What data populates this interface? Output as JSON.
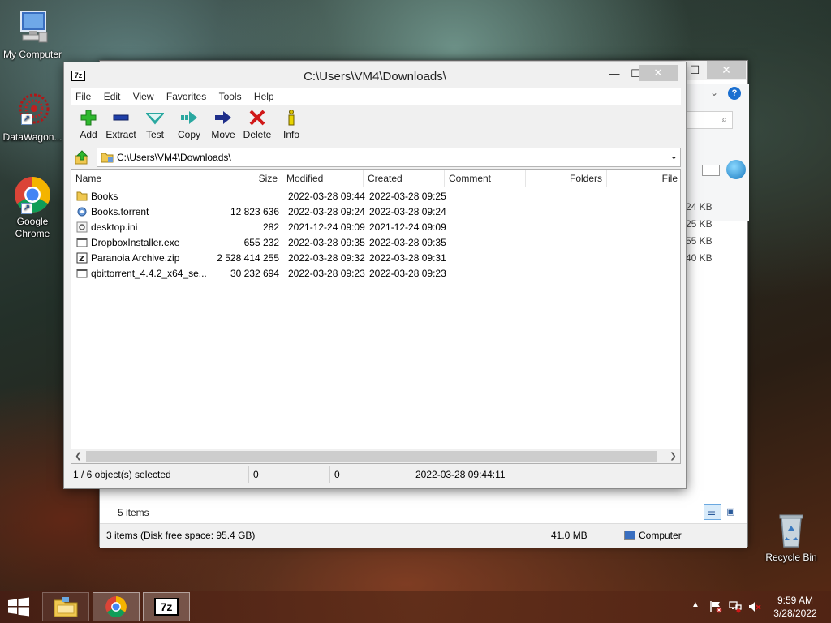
{
  "desktop": {
    "icons": [
      {
        "label": "My Computer"
      },
      {
        "label": "DataWagon..."
      },
      {
        "label": "Google Chrome"
      },
      {
        "label": "Recycle Bin"
      }
    ]
  },
  "bg_window": {
    "sizes": [
      "24 KB",
      "25 KB",
      "55 KB",
      "40 KB"
    ],
    "items_count": "5 items",
    "status_text": "3 items (Disk free space: 95.4 GB)",
    "status_size": "41.0 MB",
    "status_location": "Computer"
  },
  "window": {
    "title": "C:\\Users\\VM4\\Downloads\\",
    "app_icon": "7z",
    "menu": [
      "File",
      "Edit",
      "View",
      "Favorites",
      "Tools",
      "Help"
    ],
    "toolbar": [
      {
        "label": "Add",
        "icon": "plus-icon",
        "color": "#2eb82e"
      },
      {
        "label": "Extract",
        "icon": "minus-icon",
        "color": "#1f3fa8"
      },
      {
        "label": "Test",
        "icon": "check-icon",
        "color": "#2aa8a0"
      },
      {
        "label": "Copy",
        "icon": "copy-arrow-icon",
        "color": "#2aa8a0"
      },
      {
        "label": "Move",
        "icon": "move-arrow-icon",
        "color": "#1f2f8a"
      },
      {
        "label": "Delete",
        "icon": "x-icon",
        "color": "#d01818"
      },
      {
        "label": "Info",
        "icon": "info-icon",
        "color": "#d8c000"
      }
    ],
    "address": "C:\\Users\\VM4\\Downloads\\",
    "columns": [
      "Name",
      "Size",
      "Modified",
      "Created",
      "Comment",
      "Folders",
      "File"
    ],
    "files": [
      {
        "name": "Books",
        "size": "",
        "modified": "2022-03-28 09:44",
        "created": "2022-03-28 09:25",
        "icon": "folder-icon"
      },
      {
        "name": "Books.torrent",
        "size": "12 823 636",
        "modified": "2022-03-28 09:24",
        "created": "2022-03-28 09:24",
        "icon": "torrent-file-icon"
      },
      {
        "name": "desktop.ini",
        "size": "282",
        "modified": "2021-12-24 09:09",
        "created": "2021-12-24 09:09",
        "icon": "settings-file-icon"
      },
      {
        "name": "DropboxInstaller.exe",
        "size": "655 232",
        "modified": "2022-03-28 09:35",
        "created": "2022-03-28 09:35",
        "icon": "exe-file-icon"
      },
      {
        "name": "Paranoia Archive.zip",
        "size": "2 528 414 255",
        "modified": "2022-03-28 09:32",
        "created": "2022-03-28 09:31",
        "icon": "zip-file-icon"
      },
      {
        "name": "qbittorrent_4.4.2_x64_se...",
        "size": "30 232 694",
        "modified": "2022-03-28 09:23",
        "created": "2022-03-28 09:23",
        "icon": "exe-file-icon"
      }
    ],
    "status": {
      "selection": "1 / 6 object(s) selected",
      "size1": "0",
      "size2": "0",
      "datetime": "2022-03-28 09:44:11"
    }
  },
  "taskbar": {
    "apps": [
      "file-explorer",
      "google-chrome",
      "7-zip"
    ],
    "app_7z_label": "7z",
    "time": "9:59 AM",
    "date": "3/28/2022"
  }
}
